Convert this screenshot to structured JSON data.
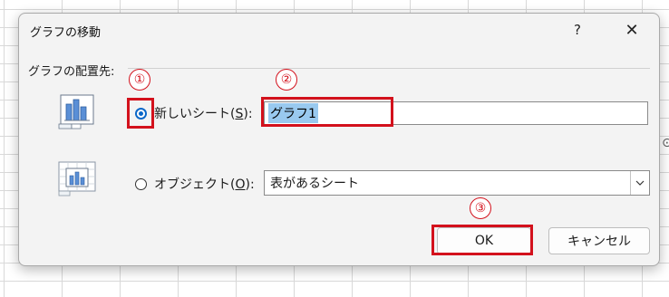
{
  "dialog": {
    "title": "グラフの移動",
    "help_label": "?",
    "close_label": "✕"
  },
  "group": {
    "label": "グラフの配置先:"
  },
  "options": {
    "new_sheet": {
      "label_prefix": "新しいシート(",
      "mnemonic": "S",
      "label_suffix": "):",
      "checked": true
    },
    "object_in": {
      "label_prefix": "オブジェクト(",
      "mnemonic": "O",
      "label_suffix": "):",
      "checked": false
    }
  },
  "new_sheet_input": {
    "value": "グラフ1"
  },
  "object_select": {
    "value": "表があるシート"
  },
  "buttons": {
    "ok": "OK",
    "cancel": "キャンセル"
  },
  "annotations": {
    "marker1": "①",
    "marker2": "②",
    "marker3": "③",
    "color": "#d3111c"
  },
  "colors": {
    "radio_accent": "#0a67c8",
    "selection": "#99c9ef"
  },
  "icons": {
    "new_sheet_chart": "chart-sheet-icon",
    "object_chart": "embedded-chart-icon",
    "dropdown": "chevron-down-icon"
  }
}
